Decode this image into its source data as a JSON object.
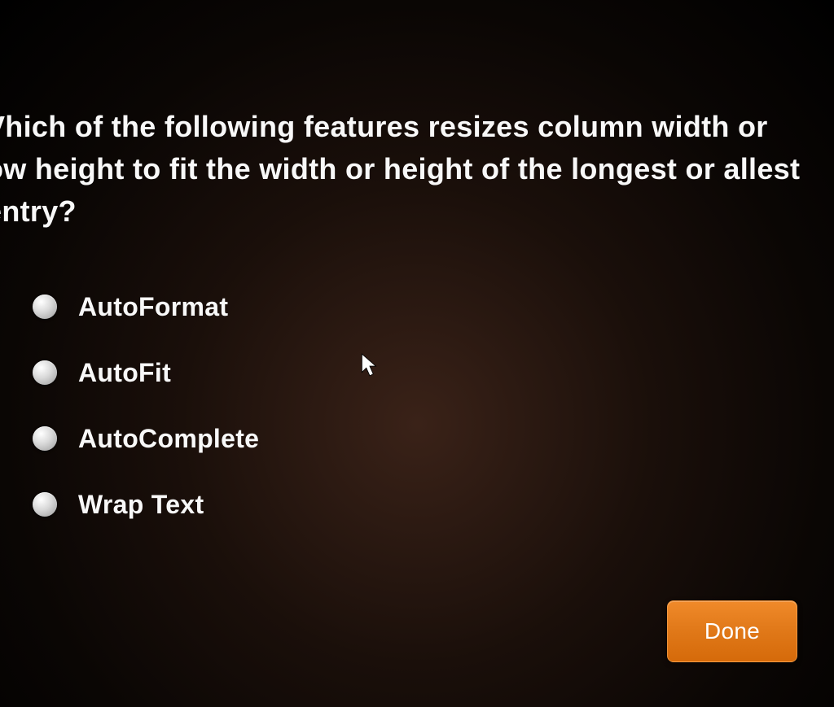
{
  "question": {
    "text": "Vhich of the following features resizes column width or ow height to fit the width or height of the longest or allest entry?"
  },
  "options": [
    {
      "label": "AutoFormat"
    },
    {
      "label": "AutoFit"
    },
    {
      "label": "AutoComplete"
    },
    {
      "label": "Wrap Text"
    }
  ],
  "buttons": {
    "done": "Done"
  }
}
